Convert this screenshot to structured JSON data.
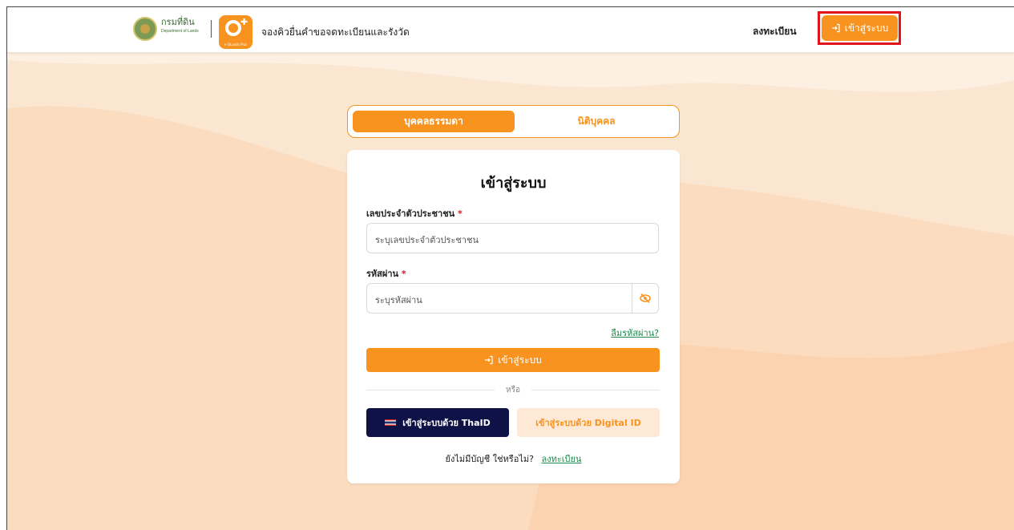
{
  "header": {
    "dol_name": "กรมที่ดิน",
    "dol_sub": "Department of Lands",
    "app_logo_text": "e-QLands Plus",
    "title": "จองคิวยื่นคำขอจดทะเบียนและรังวัด",
    "register_label": "ลงทะเบียน",
    "login_label": "เข้าสู่ระบบ"
  },
  "tabs": [
    {
      "label": "บุคคลธรรมดา",
      "active": true
    },
    {
      "label": "นิติบุคคล",
      "active": false
    }
  ],
  "form": {
    "title": "เข้าสู่ระบบ",
    "id_label": "เลขประจำตัวประชาชน",
    "id_placeholder": "ระบุเลขประจำตัวประชาชน",
    "password_label": "รหัสผ่าน",
    "password_placeholder": "ระบุรหัสผ่าน",
    "required_mark": "*",
    "forgot_label": "ลืมรหัสผ่าน?",
    "submit_label": "เข้าสู่ระบบ",
    "or_label": "หรือ",
    "thaid_label": "เข้าสู่ระบบด้วย ThaID",
    "digital_id_label": "เข้าสู่ระบบด้วย Digital ID",
    "no_account_text": "ยังไม่มีบัญชี ใช่หรือไม่?",
    "register_link": "ลงทะเบียน"
  },
  "colors": {
    "accent": "#f7931e",
    "thaid": "#0e1247",
    "link": "#1e8a4e",
    "background": "#fbe6d2",
    "highlight": "#e0141b"
  }
}
